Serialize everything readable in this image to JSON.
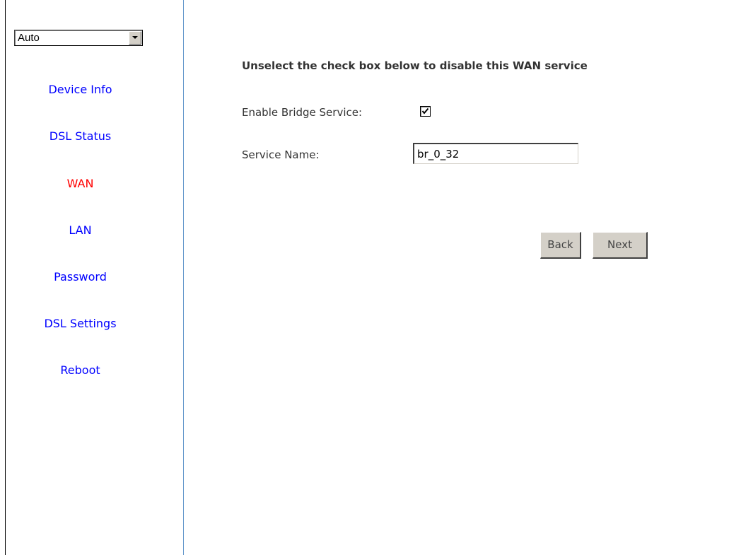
{
  "sidebar": {
    "language_select": {
      "value": "Auto"
    },
    "items": [
      {
        "label": "Device Info",
        "active": false
      },
      {
        "label": "DSL Status",
        "active": false
      },
      {
        "label": "WAN",
        "active": true
      },
      {
        "label": "LAN",
        "active": false
      },
      {
        "label": "Password",
        "active": false
      },
      {
        "label": "DSL Settings",
        "active": false
      },
      {
        "label": "Reboot",
        "active": false
      }
    ]
  },
  "main": {
    "heading": "Unselect the check box below to disable this WAN service",
    "enable_bridge": {
      "label": "Enable Bridge Service:",
      "checked": true
    },
    "service_name": {
      "label": "Service Name:",
      "value": "br_0_32"
    },
    "buttons": {
      "back": "Back",
      "next": "Next"
    }
  },
  "colors": {
    "nav_link": "#0000ff",
    "nav_active": "#ff0000",
    "sidebar_border": "#6699cc",
    "button_face": "#d4d0c8"
  }
}
